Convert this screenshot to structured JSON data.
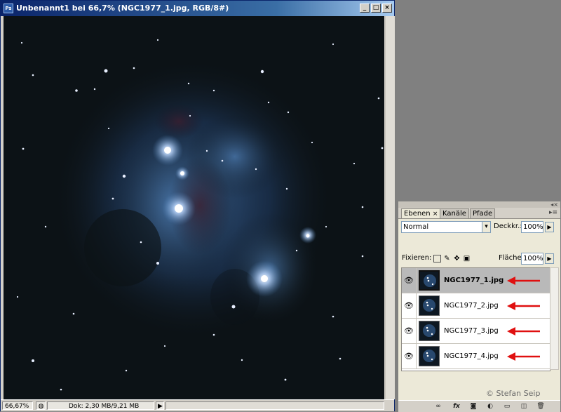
{
  "document": {
    "app_icon": "Ps",
    "title": "Unbenannt1 bei 66,7% (NGC1977_1.jpg, RGB/8#)",
    "window_buttons": {
      "minimize": "_",
      "maximize": "□",
      "close": "×"
    },
    "status": {
      "zoom": "66,67%",
      "doc_info": "Dok: 2,30 MB/9,21 MB",
      "menu_arrow": "▶"
    }
  },
  "layers_panel": {
    "tabs": [
      "Ebenen",
      "Kanäle",
      "Pfade"
    ],
    "tab_close": "×",
    "options": "▸≡",
    "blend_mode": "Normal",
    "opacity_label": "Deckkr.:",
    "opacity_value": "100%",
    "lock_label": "Fixieren:",
    "fill_label": "Fläche:",
    "fill_value": "100%",
    "arrow_glyph": "▶",
    "dropdown_glyph": "▾",
    "layers": [
      {
        "name": "NGC1977_1.jpg",
        "visible": true,
        "selected": true
      },
      {
        "name": "NGC1977_2.jpg",
        "visible": true,
        "selected": false
      },
      {
        "name": "NGC1977_3.jpg",
        "visible": true,
        "selected": false
      },
      {
        "name": "NGC1977_4.jpg",
        "visible": true,
        "selected": false
      }
    ],
    "annotation_color": "#e01010",
    "credit": "© Stefan Seip",
    "footer_icons": [
      "link-icon",
      "fx-icon",
      "mask-icon",
      "adjustment-icon",
      "group-icon",
      "new-layer-icon",
      "trash-icon"
    ],
    "footer_glyphs": {
      "link": "∞",
      "fx": "fx",
      "mask": "◙",
      "adjust": "◐",
      "group": "▭",
      "new": "◫",
      "trash": "🗑"
    }
  }
}
